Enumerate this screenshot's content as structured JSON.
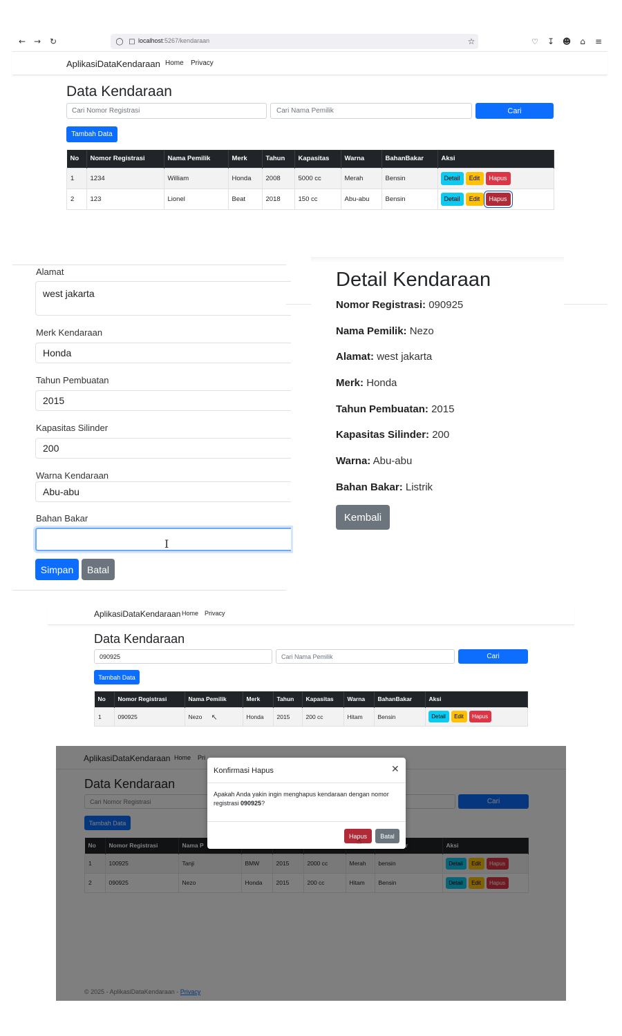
{
  "browser": {
    "url_host": "localhost",
    "url_path": ":5267/kendaraan",
    "icons": [
      "back-icon",
      "forward-icon",
      "reload-icon",
      "shield-icon",
      "page-icon",
      "star-icon",
      "pocket-icon",
      "download-icon",
      "account-icon",
      "extensions-icon",
      "menu-icon"
    ]
  },
  "nav": {
    "brand": "AplikasiDataKendaraan",
    "home": "Home",
    "privacy": "Privacy"
  },
  "list1": {
    "title": "Data Kendaraan",
    "search_reg_placeholder": "Cari Nomor Registrasi",
    "search_owner_placeholder": "Cari Nama Pemilik",
    "search_button": "Cari",
    "add_button": "Tambah Data",
    "headers": [
      "No",
      "Nomor Registrasi",
      "Nama Pemilik",
      "Merk",
      "Tahun",
      "Kapasitas",
      "Warna",
      "BahanBakar",
      "Aksi"
    ],
    "rows": [
      [
        "1",
        "1234",
        "William",
        "Honda",
        "2008",
        "5000 cc",
        "Merah",
        "Bensin"
      ],
      [
        "2",
        "123",
        "Lionel",
        "Beat",
        "2018",
        "150 cc",
        "Abu-abu",
        "Bensin"
      ]
    ],
    "detail_label": "Detail",
    "edit_label": "Edit",
    "delete_label": "Hapus"
  },
  "form": {
    "alamat_label": "Alamat",
    "alamat_value": "west jakarta",
    "merk_label": "Merk Kendaraan",
    "merk_value": "Honda",
    "tahun_label": "Tahun Pembuatan",
    "tahun_value": "2015",
    "kapasitas_label": "Kapasitas Silinder",
    "kapasitas_value": "200",
    "warna_label": "Warna Kendaraan",
    "warna_value": "Abu-abu",
    "bahan_label": "Bahan Bakar",
    "bahan_value": "",
    "save_button": "Simpan",
    "cancel_button": "Batal"
  },
  "detail": {
    "title": "Detail Kendaraan",
    "nomor_label": "Nomor Registrasi:",
    "nomor_value": "090925",
    "nama_label": "Nama Pemilik:",
    "nama_value": "Nezo",
    "alamat_label": "Alamat:",
    "alamat_value": "west jakarta",
    "merk_label": "Merk:",
    "merk_value": "Honda",
    "tahun_label": "Tahun Pembuatan:",
    "tahun_value": "2015",
    "kapasitas_label": "Kapasitas Silinder:",
    "kapasitas_value": "200",
    "warna_label": "Warna:",
    "warna_value": "Abu-abu",
    "bahan_label": "Bahan Bakar:",
    "bahan_value": "Listrik",
    "back_button": "Kembali"
  },
  "list2": {
    "title": "Data Kendaraan",
    "search_reg_value": "090925",
    "search_owner_placeholder": "Cari Nama Pemilik",
    "search_button": "Cari",
    "add_button": "Tambah Data",
    "headers": [
      "No",
      "Nomor Registrasi",
      "Nama Pemilik",
      "Merk",
      "Tahun",
      "Kapasitas",
      "Warna",
      "BahanBakar",
      "Aksi"
    ],
    "rows": [
      [
        "1",
        "090925",
        "Nezo",
        "Honda",
        "2015",
        "200 cc",
        "Hitam",
        "Bensin"
      ]
    ],
    "detail_label": "Detail",
    "edit_label": "Edit",
    "delete_label": "Hapus"
  },
  "list3": {
    "title": "Data Kendaraan",
    "search_reg_placeholder": "Cari Nomor Registrasi",
    "search_button": "Cari",
    "add_button": "Tambah Data",
    "headers_left": [
      "No",
      "Nomor Registrasi",
      "Nama P"
    ],
    "headers_right": [
      "Bakar",
      "Aksi"
    ],
    "rows": [
      [
        "1",
        "100925",
        "Tanji",
        "BMW",
        "2015",
        "2000 cc",
        "Merah",
        "bensin"
      ],
      [
        "2",
        "090925",
        "Nezo",
        "Honda",
        "2015",
        "200 cc",
        "Hitam",
        "Bensin"
      ]
    ],
    "detail_label": "Detail",
    "edit_label": "Edit",
    "delete_label": "Hapus",
    "nav_privacy_partial": "Pri",
    "footer_text": "© 2025 - AplikasiDataKendaraan - ",
    "footer_link": "Privacy"
  },
  "modal": {
    "title": "Konfirmasi Hapus",
    "body_prefix": "Apakah Anda yakin ingin menghapus kendaraan dengan nomor registrasi ",
    "body_number": "090925",
    "body_suffix": "?",
    "confirm_button": "Hapus",
    "cancel_button": "Batal"
  },
  "colors": {
    "primary": "#0d6efd",
    "info": "#0dcaf0",
    "warning": "#ffc107",
    "danger": "#dc3545",
    "secondary": "#6c757d",
    "table_header": "#212529"
  }
}
